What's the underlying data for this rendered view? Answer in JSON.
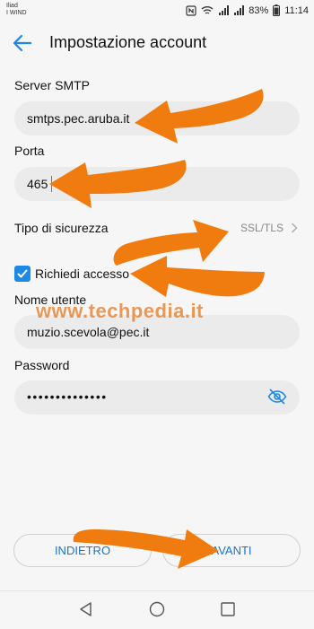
{
  "status": {
    "carrier_line1": "Iliad",
    "carrier_line2": "I WIND",
    "battery": "83%",
    "time": "11:14"
  },
  "header": {
    "title": "Impostazione account"
  },
  "form": {
    "server_label": "Server SMTP",
    "server_value": "smtps.pec.aruba.it",
    "port_label": "Porta",
    "port_value": "465",
    "security_label": "Tipo di sicurezza",
    "security_value": "SSL/TLS",
    "auth_label": "Richiedi accesso",
    "auth_checked": true,
    "username_label": "Nome utente",
    "username_value": "muzio.scevola@pec.it",
    "password_label": "Password",
    "password_value": "••••••••••••••"
  },
  "watermark": "www.techpedia.it",
  "buttons": {
    "back": "INDIETRO",
    "next": "AVANTI"
  },
  "colors": {
    "accent": "#1e88e5",
    "arrow": "#f07c10",
    "field_bg": "#ebebeb"
  }
}
